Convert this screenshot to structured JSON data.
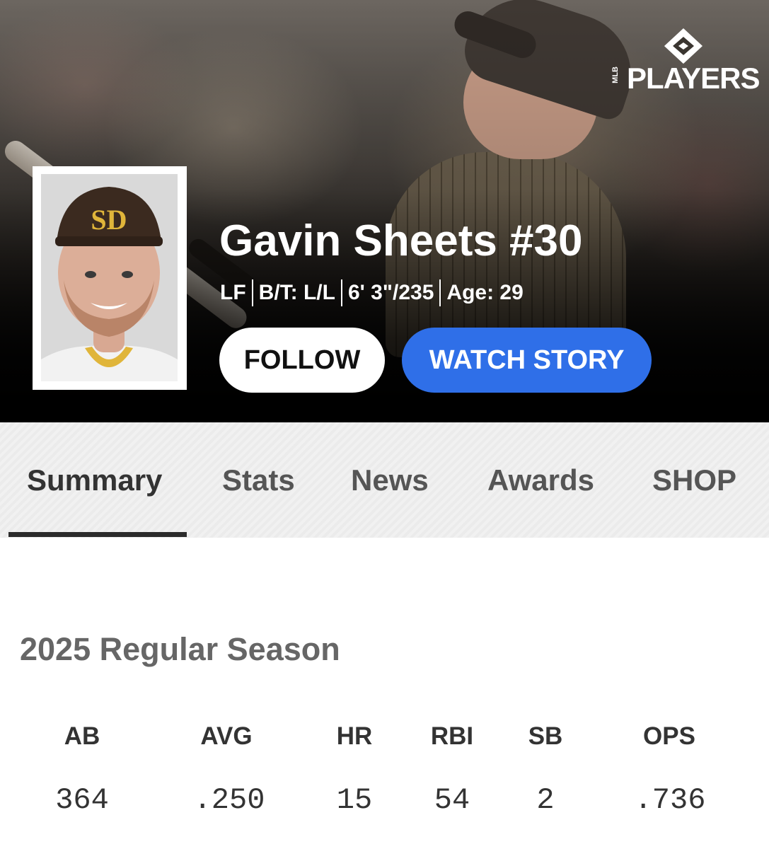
{
  "hero": {
    "brand": {
      "icon": "mlb-players-logo-icon",
      "small_text": "MLB",
      "text": "PLAYERS"
    },
    "player": {
      "name": "Gavin Sheets #30",
      "position": "LF",
      "bats_throws": "B/T: L/L",
      "height_weight": "6' 3\"/235",
      "age": "Age: 29"
    },
    "buttons": {
      "follow": "FOLLOW",
      "watch_story": "WATCH STORY"
    },
    "colors": {
      "watch_button": "#2f6fe8"
    }
  },
  "tabs": [
    {
      "label": "Summary",
      "active": true
    },
    {
      "label": "Stats",
      "active": false
    },
    {
      "label": "News",
      "active": false
    },
    {
      "label": "Awards",
      "active": false
    },
    {
      "label": "SHOP",
      "active": false
    }
  ],
  "season": {
    "title": "2025 Regular Season",
    "stats": [
      {
        "label": "AB",
        "value": "364"
      },
      {
        "label": "AVG",
        "value": ".250"
      },
      {
        "label": "HR",
        "value": "15"
      },
      {
        "label": "RBI",
        "value": "54"
      },
      {
        "label": "SB",
        "value": "2"
      },
      {
        "label": "OPS",
        "value": ".736"
      }
    ]
  }
}
